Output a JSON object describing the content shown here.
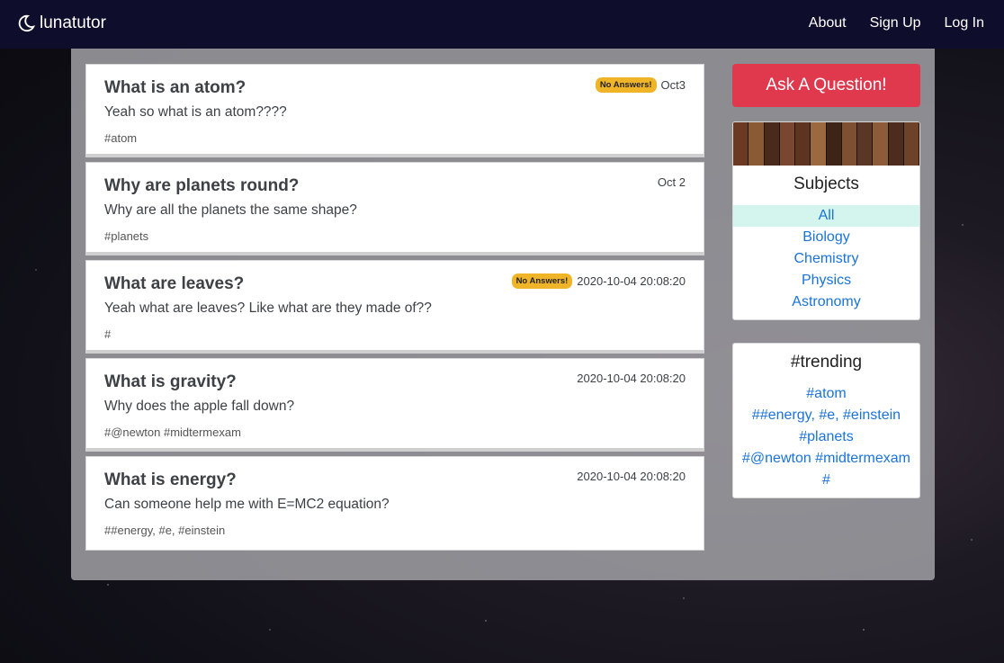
{
  "nav": {
    "brand": "lunatutor",
    "links": [
      "About",
      "Sign Up",
      "Log In"
    ]
  },
  "questions": [
    {
      "title": "What is an atom?",
      "body": "Yeah so what is an atom????",
      "tags": "#atom",
      "badge": "No Answers!",
      "date": "Oct3"
    },
    {
      "title": "Why are planets round?",
      "body": "Why are all the planets the same shape?",
      "tags": "#planets",
      "badge": "",
      "date": "Oct 2"
    },
    {
      "title": "What are leaves?",
      "body": "Yeah what are leaves? Like what are they made of??",
      "tags": "#",
      "badge": "No Answers!",
      "date": "2020-10-04 20:08:20"
    },
    {
      "title": "What is gravity?",
      "body": "Why does the apple fall down?",
      "tags": "#@newton #midtermexam",
      "badge": "",
      "date": "2020-10-04 20:08:20"
    },
    {
      "title": "What is energy?",
      "body": "Can someone help me with E=MC2 equation?",
      "tags": "##energy, #e, #einstein",
      "badge": "",
      "date": "2020-10-04 20:08:20"
    }
  ],
  "sidebar": {
    "ask_label": "Ask A Question!",
    "subjects_title": "Subjects",
    "subjects": [
      "All",
      "Biology",
      "Chemistry",
      "Physics",
      "Astronomy"
    ],
    "trending_title": "#trending",
    "trending": [
      "#atom",
      "##energy, #e, #einstein",
      "#planets",
      "#@newton #midtermexam",
      "#"
    ]
  },
  "colors": {
    "navbar": "#0e0e2c",
    "accent_button": "#e0384c",
    "badge": "#f0b429",
    "link": "#1a73d8"
  }
}
